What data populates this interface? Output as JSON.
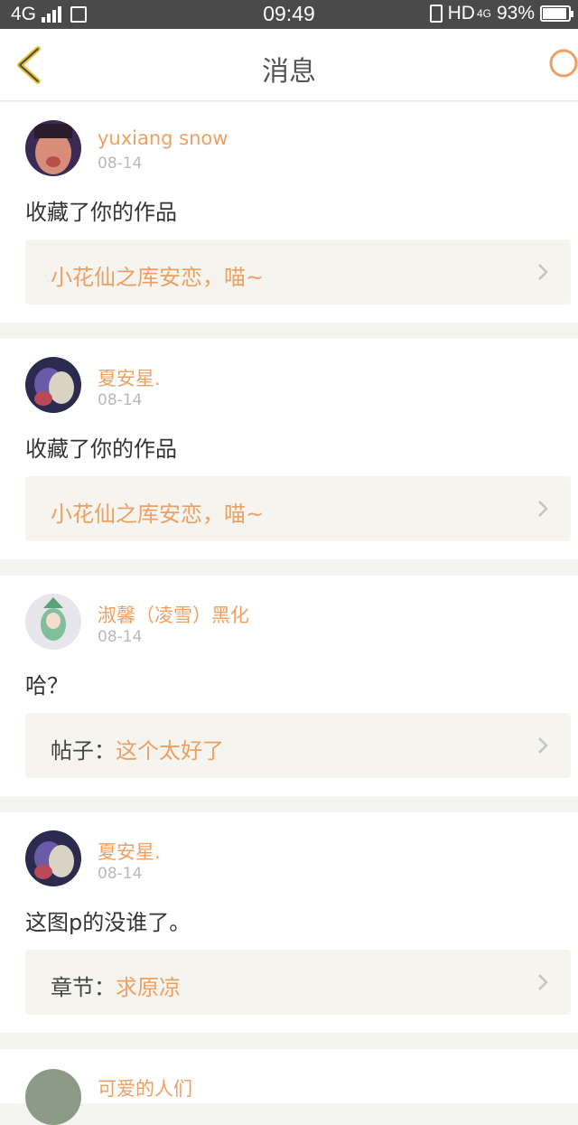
{
  "status_bar": {
    "network": "4G",
    "time": "09:49",
    "hd": "HD",
    "hd_network": "4G",
    "battery_percent": "93%",
    "battery_level": 0.93
  },
  "header": {
    "title": "消息"
  },
  "colors": {
    "accent": "#eda063",
    "text": "#333333",
    "muted": "#b9b9b9",
    "ref_bg": "#f5f4ee"
  },
  "messages": [
    {
      "user": "yuxiang snow",
      "date": "08-14",
      "text": "收藏了你的作品",
      "ref_prefix": "",
      "ref_link": "小花仙之库安恋，喵~"
    },
    {
      "user": "夏安星.",
      "date": "08-14",
      "text": "收藏了你的作品",
      "ref_prefix": "",
      "ref_link": "小花仙之库安恋，喵~"
    },
    {
      "user": "淑馨（凌雪）黑化",
      "date": "08-14",
      "text": "哈？",
      "ref_prefix": "帖子：",
      "ref_link": "这个太好了"
    },
    {
      "user": "夏安星.",
      "date": "08-14",
      "text": "这图p的没谁了。",
      "ref_prefix": "章节：",
      "ref_link": "求原凉"
    }
  ],
  "partial_message": {
    "user": "可爱的人们"
  }
}
